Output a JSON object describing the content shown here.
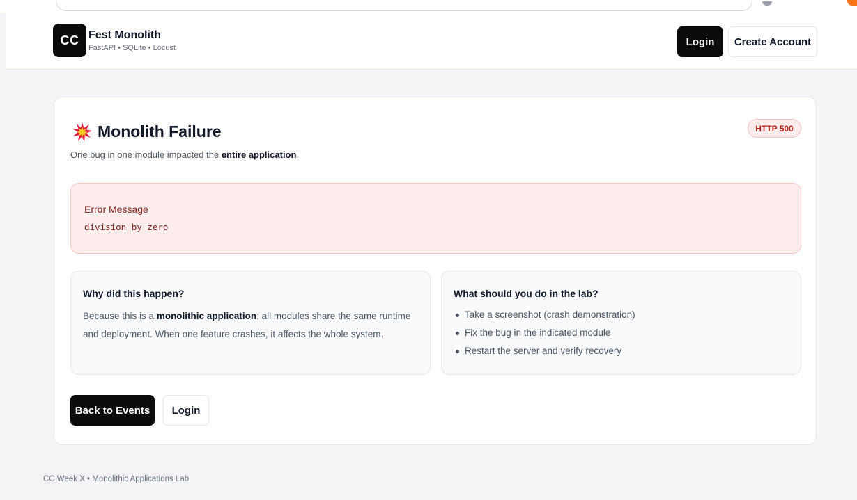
{
  "header": {
    "logo_text": "CC",
    "app_name": "Fest Monolith",
    "app_subtitle": "FastAPI • SQLite • Locust",
    "login_label": "Login",
    "create_account_label": "Create Account"
  },
  "error_page": {
    "icon": "explosion-icon",
    "title": "Monolith Failure",
    "subtitle_prefix": "One bug in one module impacted the ",
    "subtitle_bold": "entire application",
    "subtitle_suffix": ".",
    "status_badge": "HTTP 500",
    "error_label": "Error Message",
    "error_message": "division by zero"
  },
  "why_panel": {
    "heading": "Why did this happen?",
    "text_prefix": "Because this is a ",
    "text_bold": "monolithic application",
    "text_suffix": ": all modules share the same runtime and deployment. When one feature crashes, it affects the whole system."
  },
  "lab_panel": {
    "heading": "What should you do in the lab?",
    "items": [
      "Take a screenshot (crash demonstration)",
      "Fix the bug in the indicated module",
      "Restart the server and verify recovery"
    ]
  },
  "actions": {
    "back_label": "Back to Events",
    "login_label": "Login"
  },
  "footer": {
    "text": "CC Week X • Monolithic Applications Lab"
  },
  "colors": {
    "primary_dark": "#0b0b0b",
    "error_bg": "#fdecec",
    "error_text": "#7a1f1f",
    "badge_text": "#b42318",
    "page_bg": "#f3f4f6"
  }
}
